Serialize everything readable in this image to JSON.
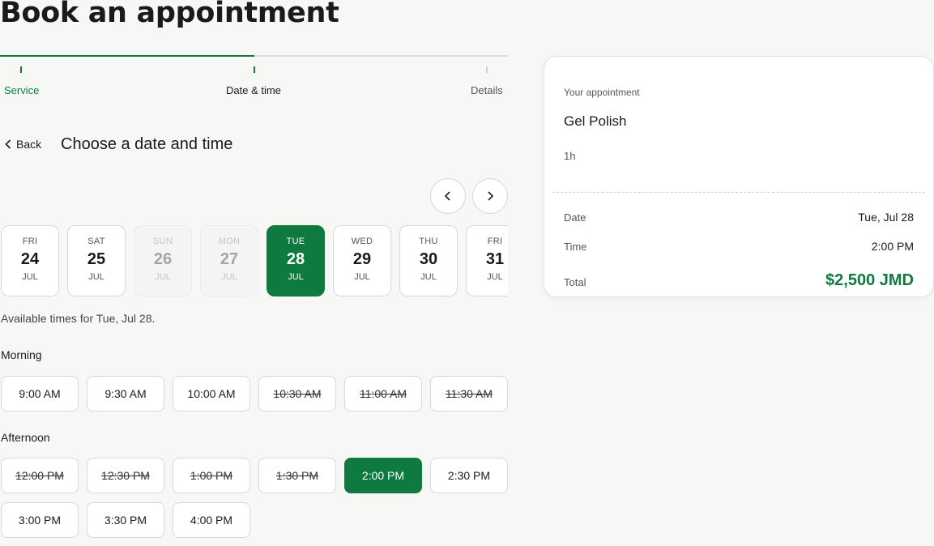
{
  "page_title": "Book an appointment",
  "steps": [
    {
      "label": "Service"
    },
    {
      "label": "Date & time"
    },
    {
      "label": "Details"
    }
  ],
  "back_label": "Back",
  "section_title": "Choose a date and time",
  "dates": [
    {
      "dow": "FRI",
      "day": "24",
      "mon": "JUL",
      "state": "available"
    },
    {
      "dow": "SAT",
      "day": "25",
      "mon": "JUL",
      "state": "available"
    },
    {
      "dow": "SUN",
      "day": "26",
      "mon": "JUL",
      "state": "disabled"
    },
    {
      "dow": "MON",
      "day": "27",
      "mon": "JUL",
      "state": "disabled"
    },
    {
      "dow": "TUE",
      "day": "28",
      "mon": "JUL",
      "state": "selected"
    },
    {
      "dow": "WED",
      "day": "29",
      "mon": "JUL",
      "state": "available"
    },
    {
      "dow": "THU",
      "day": "30",
      "mon": "JUL",
      "state": "available"
    },
    {
      "dow": "FRI",
      "day": "31",
      "mon": "JUL",
      "state": "available"
    }
  ],
  "available_text": "Available times for Tue, Jul 28.",
  "morning": {
    "label": "Morning",
    "slots": [
      {
        "time": "9:00 AM",
        "state": "available"
      },
      {
        "time": "9:30 AM",
        "state": "available"
      },
      {
        "time": "10:00 AM",
        "state": "available"
      },
      {
        "time": "10:30 AM",
        "state": "unavailable"
      },
      {
        "time": "11:00 AM",
        "state": "unavailable"
      },
      {
        "time": "11:30 AM",
        "state": "unavailable"
      }
    ]
  },
  "afternoon": {
    "label": "Afternoon",
    "slots": [
      {
        "time": "12:00 PM",
        "state": "unavailable"
      },
      {
        "time": "12:30 PM",
        "state": "unavailable"
      },
      {
        "time": "1:00 PM",
        "state": "unavailable"
      },
      {
        "time": "1:30 PM",
        "state": "unavailable"
      },
      {
        "time": "2:00 PM",
        "state": "selected"
      },
      {
        "time": "2:30 PM",
        "state": "available"
      },
      {
        "time": "3:00 PM",
        "state": "available"
      },
      {
        "time": "3:30 PM",
        "state": "available"
      },
      {
        "time": "4:00 PM",
        "state": "available"
      }
    ]
  },
  "summary": {
    "kicker": "Your appointment",
    "service": "Gel Polish",
    "duration": "1h",
    "date_label": "Date",
    "date_value": "Tue, Jul 28",
    "time_label": "Time",
    "time_value": "2:00 PM",
    "total_label": "Total",
    "total_value": "$2,500 JMD"
  },
  "colors": {
    "accent": "#0f7a3f",
    "background": "#f7f7f6"
  },
  "icons": {
    "back": "chevron-left-icon",
    "prev": "chevron-left-icon",
    "next": "chevron-right-icon"
  }
}
